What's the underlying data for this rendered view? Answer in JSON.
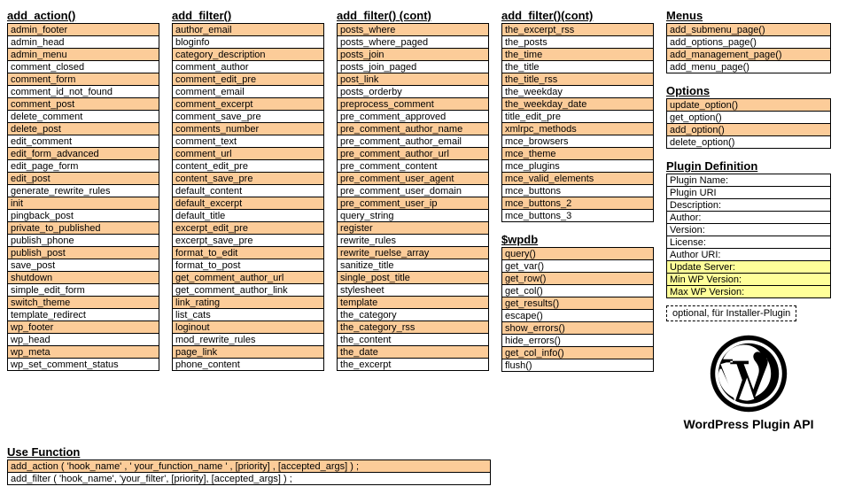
{
  "columns": [
    {
      "header": "add_action()",
      "items": [
        {
          "t": "admin_footer",
          "c": "orange"
        },
        {
          "t": "admin_head",
          "c": ""
        },
        {
          "t": "admin_menu",
          "c": "orange"
        },
        {
          "t": "comment_closed",
          "c": ""
        },
        {
          "t": "comment_form",
          "c": "orange"
        },
        {
          "t": "comment_id_not_found",
          "c": ""
        },
        {
          "t": "comment_post",
          "c": "orange"
        },
        {
          "t": "delete_comment",
          "c": ""
        },
        {
          "t": "delete_post",
          "c": "orange"
        },
        {
          "t": "edit_comment",
          "c": ""
        },
        {
          "t": "edit_form_advanced",
          "c": "orange"
        },
        {
          "t": "edit_page_form",
          "c": ""
        },
        {
          "t": "edit_post",
          "c": "orange"
        },
        {
          "t": "generate_rewrite_rules",
          "c": ""
        },
        {
          "t": "init",
          "c": "orange"
        },
        {
          "t": "pingback_post",
          "c": ""
        },
        {
          "t": "private_to_published",
          "c": "orange"
        },
        {
          "t": "publish_phone",
          "c": ""
        },
        {
          "t": "publish_post",
          "c": "orange"
        },
        {
          "t": "save_post",
          "c": ""
        },
        {
          "t": "shutdown",
          "c": "orange"
        },
        {
          "t": "simple_edit_form",
          "c": ""
        },
        {
          "t": "switch_theme",
          "c": "orange"
        },
        {
          "t": "template_redirect",
          "c": ""
        },
        {
          "t": "wp_footer",
          "c": "orange"
        },
        {
          "t": "wp_head",
          "c": ""
        },
        {
          "t": "wp_meta",
          "c": "orange"
        },
        {
          "t": "wp_set_comment_status",
          "c": ""
        }
      ]
    },
    {
      "header": "add_filter()",
      "items": [
        {
          "t": "author_email",
          "c": "orange"
        },
        {
          "t": "bloginfo",
          "c": ""
        },
        {
          "t": "category_description",
          "c": "orange"
        },
        {
          "t": "comment_author",
          "c": ""
        },
        {
          "t": "comment_edit_pre",
          "c": "orange"
        },
        {
          "t": "comment_email",
          "c": ""
        },
        {
          "t": "comment_excerpt",
          "c": "orange"
        },
        {
          "t": "comment_save_pre",
          "c": ""
        },
        {
          "t": "comments_number",
          "c": "orange"
        },
        {
          "t": "comment_text",
          "c": ""
        },
        {
          "t": "comment_url",
          "c": "orange"
        },
        {
          "t": "content_edit_pre",
          "c": ""
        },
        {
          "t": "content_save_pre",
          "c": "orange"
        },
        {
          "t": "default_content",
          "c": ""
        },
        {
          "t": "default_excerpt",
          "c": "orange"
        },
        {
          "t": "default_title",
          "c": ""
        },
        {
          "t": "excerpt_edit_pre",
          "c": "orange"
        },
        {
          "t": "excerpt_save_pre",
          "c": ""
        },
        {
          "t": "format_to_edit",
          "c": "orange"
        },
        {
          "t": "format_to_post",
          "c": ""
        },
        {
          "t": "get_comment_author_url",
          "c": "orange"
        },
        {
          "t": "get_comment_author_link",
          "c": ""
        },
        {
          "t": "link_rating",
          "c": "orange"
        },
        {
          "t": "list_cats",
          "c": ""
        },
        {
          "t": "loginout",
          "c": "orange"
        },
        {
          "t": "mod_rewrite_rules",
          "c": ""
        },
        {
          "t": "page_link",
          "c": "orange"
        },
        {
          "t": "phone_content",
          "c": ""
        }
      ]
    },
    {
      "header": "add_filter() (cont)",
      "items": [
        {
          "t": "posts_where",
          "c": "orange"
        },
        {
          "t": "posts_where_paged",
          "c": ""
        },
        {
          "t": "posts_join",
          "c": "orange"
        },
        {
          "t": "posts_join_paged",
          "c": ""
        },
        {
          "t": "post_link",
          "c": "orange"
        },
        {
          "t": "posts_orderby",
          "c": ""
        },
        {
          "t": "preprocess_comment",
          "c": "orange"
        },
        {
          "t": "pre_comment_approved",
          "c": ""
        },
        {
          "t": "pre_comment_author_name",
          "c": "orange"
        },
        {
          "t": "pre_comment_author_email",
          "c": ""
        },
        {
          "t": "pre_comment_author_url",
          "c": "orange"
        },
        {
          "t": "pre_comment_content",
          "c": ""
        },
        {
          "t": "pre_comment_user_agent",
          "c": "orange"
        },
        {
          "t": "pre_comment_user_domain",
          "c": ""
        },
        {
          "t": "pre_comment_user_ip",
          "c": "orange"
        },
        {
          "t": "query_string",
          "c": ""
        },
        {
          "t": "register",
          "c": "orange"
        },
        {
          "t": "rewrite_rules",
          "c": ""
        },
        {
          "t": "rewrite_ruelse_array",
          "c": "orange"
        },
        {
          "t": "sanitize_title",
          "c": ""
        },
        {
          "t": "single_post_title",
          "c": "orange"
        },
        {
          "t": "stylesheet",
          "c": ""
        },
        {
          "t": "template",
          "c": "orange"
        },
        {
          "t": "the_category",
          "c": ""
        },
        {
          "t": "the_category_rss",
          "c": "orange"
        },
        {
          "t": "the_content",
          "c": ""
        },
        {
          "t": "the_date",
          "c": "orange"
        },
        {
          "t": "the_excerpt",
          "c": ""
        }
      ]
    }
  ],
  "col3": {
    "secA": {
      "header": "add_filter()(cont)",
      "items": [
        {
          "t": "the_excerpt_rss",
          "c": "orange"
        },
        {
          "t": "the_posts",
          "c": ""
        },
        {
          "t": "the_time",
          "c": "orange"
        },
        {
          "t": "the_title",
          "c": ""
        },
        {
          "t": "the_title_rss",
          "c": "orange"
        },
        {
          "t": "the_weekday",
          "c": ""
        },
        {
          "t": "the_weekday_date",
          "c": "orange"
        },
        {
          "t": "title_edit_pre",
          "c": ""
        },
        {
          "t": "xmlrpc_methods",
          "c": "orange"
        },
        {
          "t": "mce_browsers",
          "c": ""
        },
        {
          "t": "mce_theme",
          "c": "orange"
        },
        {
          "t": "mce_plugins",
          "c": ""
        },
        {
          "t": "mce_valid_elements",
          "c": "orange"
        },
        {
          "t": "mce_buttons",
          "c": ""
        },
        {
          "t": "mce_buttons_2",
          "c": "orange"
        },
        {
          "t": "mce_buttons_3",
          "c": ""
        }
      ]
    },
    "secB": {
      "header": "$wpdb",
      "items": [
        {
          "t": "query()",
          "c": "orange"
        },
        {
          "t": "get_var()",
          "c": ""
        },
        {
          "t": "get_row()",
          "c": "orange"
        },
        {
          "t": "get_col()",
          "c": ""
        },
        {
          "t": "get_results()",
          "c": "orange"
        },
        {
          "t": "escape()",
          "c": ""
        },
        {
          "t": "show_errors()",
          "c": "orange"
        },
        {
          "t": "hide_errors()",
          "c": ""
        },
        {
          "t": "get_col_info()",
          "c": "orange"
        },
        {
          "t": "flush()",
          "c": ""
        }
      ]
    }
  },
  "col4": {
    "menus": {
      "header": "Menus",
      "items": [
        {
          "t": "add_submenu_page()",
          "c": "orange"
        },
        {
          "t": "add_options_page()",
          "c": ""
        },
        {
          "t": "add_management_page()",
          "c": "orange"
        },
        {
          "t": "add_menu_page()",
          "c": ""
        }
      ]
    },
    "options": {
      "header": "Options",
      "items": [
        {
          "t": "update_option()",
          "c": "orange"
        },
        {
          "t": "get_option()",
          "c": ""
        },
        {
          "t": "add_option()",
          "c": "orange"
        },
        {
          "t": "delete_option()",
          "c": ""
        }
      ]
    },
    "plugin_def": {
      "header": "Plugin Definition",
      "items": [
        {
          "t": "Plugin Name:",
          "c": ""
        },
        {
          "t": "Plugin URI",
          "c": ""
        },
        {
          "t": "Description:",
          "c": ""
        },
        {
          "t": "Author:",
          "c": ""
        },
        {
          "t": "Version:",
          "c": ""
        },
        {
          "t": "License:",
          "c": ""
        },
        {
          "t": "Author URI:",
          "c": ""
        },
        {
          "t": "Update Server:",
          "c": "yellow"
        },
        {
          "t": "Min WP Version:",
          "c": "yellow"
        },
        {
          "t": "Max WP Version:",
          "c": "yellow"
        }
      ]
    },
    "legend": "optional, für Installer-Plugin",
    "brand": "WordPress Plugin API"
  },
  "usefn": {
    "header": "Use Function",
    "items": [
      {
        "t": "add_action ( 'hook_name' , ' your_function_name ' , [priority] , [accepted_args] ) ;",
        "c": "orange"
      },
      {
        "t": "add_filter ( 'hook_name', 'your_filter', [priority], [accepted_args] ) ;",
        "c": ""
      }
    ]
  }
}
